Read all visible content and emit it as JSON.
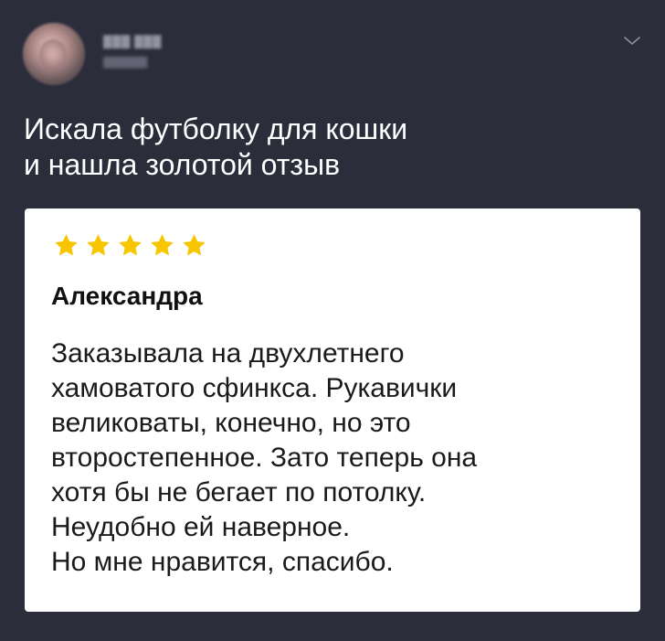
{
  "post": {
    "text_lines": [
      "Искала футболку для кошки",
      "и нашла золотой отзыв"
    ]
  },
  "review": {
    "rating": 5,
    "max_rating": 5,
    "author": "Александра",
    "lines": [
      "Заказывала на двухлетнего",
      "хамоватого сфинкса. Рукавички",
      "великоваты, конечно, но это",
      "второстепенное. Зато теперь она",
      "хотя бы не бегает по потолку.",
      "Неудобно ей наверное.",
      "Но мне нравится, спасибо."
    ]
  },
  "icons": {
    "menu": "chevron-down-icon",
    "rating": "star-icon"
  },
  "colors": {
    "background": "#2b2d3b",
    "card": "#ffffff",
    "star": "#f7c600",
    "post_text": "#ffffff",
    "review_text": "#1a1a1a"
  }
}
